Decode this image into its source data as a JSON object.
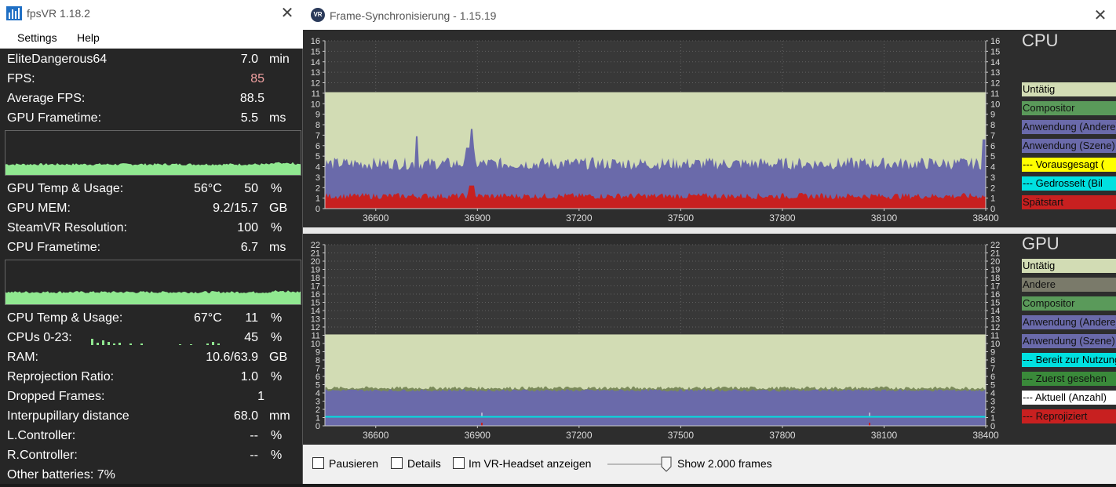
{
  "fpsvr": {
    "title": "fpsVR 1.18.2",
    "menu": [
      "Settings",
      "Help"
    ],
    "rows": [
      {
        "label": "EliteDangerous64",
        "value": "7.0",
        "unit": "min"
      },
      {
        "label": "FPS:",
        "value": "85",
        "unit": "",
        "value_color": "#f0a0a0"
      },
      {
        "label": "Average FPS:",
        "value": "88.5",
        "unit": ""
      },
      {
        "label": "GPU Frametime:",
        "value": "5.5",
        "unit": "ms"
      },
      {
        "label": "GPU Temp & Usage:",
        "value": "56°C",
        "value2": "50",
        "unit": "%"
      },
      {
        "label": "GPU MEM:",
        "value": "9.2/15.7",
        "unit": "GB"
      },
      {
        "label": "SteamVR Resolution:",
        "value": "100",
        "unit": "%"
      },
      {
        "label": "CPU Frametime:",
        "value": "6.7",
        "unit": "ms"
      },
      {
        "label": "CPU Temp & Usage:",
        "value": "67°C",
        "value2": "11",
        "unit": "%"
      },
      {
        "label": "CPUs 0-23:",
        "value": "45",
        "unit": "%"
      },
      {
        "label": "RAM:",
        "value": "10.6/63.9",
        "unit": "GB"
      },
      {
        "label": "Reprojection Ratio:",
        "value": "1.0",
        "unit": "%"
      },
      {
        "label": "Dropped Frames:",
        "value": "1",
        "unit": ""
      },
      {
        "label": "Interpupillary distance",
        "value": "68.0",
        "unit": "mm"
      },
      {
        "label": "L.Controller:",
        "value": "--",
        "unit": "%"
      },
      {
        "label": "R.Controller:",
        "value": "--",
        "unit": "%"
      },
      {
        "label": "Other batteries: 7%",
        "value": "",
        "unit": ""
      }
    ],
    "graph_color": "#90e890"
  },
  "framesync": {
    "title": "Frame-Synchronisierung - 1.15.19",
    "cpu_label": "CPU",
    "gpu_label": "GPU",
    "cpu_legend": [
      {
        "label": "Untätig",
        "color": "#d2dcb4"
      },
      {
        "label": "Compositor",
        "color": "#5a9a5a"
      },
      {
        "label": "Anwendung (Andere)",
        "color": "#6a6aaa"
      },
      {
        "label": "Anwendung (Szene)",
        "color": "#6a6aaa"
      },
      {
        "label": "--- Vorausgesagt (",
        "color": "#ffff00"
      },
      {
        "label": "--- Gedrosselt (Bil",
        "color": "#00e0e0"
      },
      {
        "label": "Spätstart",
        "color": "#c82020"
      }
    ],
    "gpu_legend": [
      {
        "label": "Untätig",
        "color": "#d2dcb4"
      },
      {
        "label": "Andere",
        "color": "#7a7a6a"
      },
      {
        "label": "Compositor",
        "color": "#5a9a5a"
      },
      {
        "label": "Anwendung (Andere)",
        "color": "#6a6aaa"
      },
      {
        "label": "Anwendung (Szene)",
        "color": "#6a6aaa"
      },
      {
        "label": "--- Bereit zur Nutzung",
        "color": "#00e0e0"
      },
      {
        "label": "--- Zuerst gesehen",
        "color": "#3a8a3a"
      },
      {
        "label": "--- Aktuell (Anzahl)",
        "color": "#ffffff"
      },
      {
        "label": "--- Reprojiziert",
        "color": "#c82020"
      }
    ],
    "x_ticks": [
      "36600",
      "36900",
      "37200",
      "37500",
      "37800",
      "38100",
      "38400"
    ],
    "controls": {
      "pause": "Pausieren",
      "details": "Details",
      "headset": "Im VR-Headset anzeigen",
      "frames": "Show 2.000 frames"
    }
  },
  "chart_data": [
    {
      "type": "area",
      "title": "CPU",
      "x_ticks": [
        36600,
        36900,
        37200,
        37500,
        37800,
        38100,
        38400
      ],
      "xlim": [
        36450,
        38400
      ],
      "ylim": [
        0,
        16
      ],
      "y_ticks": [
        0,
        1,
        2,
        3,
        4,
        5,
        6,
        7,
        8,
        9,
        10,
        11,
        12,
        13,
        14,
        15,
        16
      ],
      "series": [
        {
          "name": "Untätig",
          "values": [
            11.1
          ]
        },
        {
          "name": "Anwendung (Szene)",
          "approx_level": [
            4.3
          ]
        },
        {
          "name": "Spätstart",
          "approx_level": [
            1.3
          ]
        }
      ]
    },
    {
      "type": "area",
      "title": "GPU",
      "x_ticks": [
        36600,
        36900,
        37200,
        37500,
        37800,
        38100,
        38400
      ],
      "xlim": [
        36450,
        38400
      ],
      "ylim": [
        0,
        22
      ],
      "y_ticks": [
        0,
        1,
        2,
        3,
        4,
        5,
        6,
        7,
        8,
        9,
        10,
        11,
        12,
        13,
        14,
        15,
        16,
        17,
        18,
        19,
        20,
        21,
        22
      ],
      "series": [
        {
          "name": "Untätig",
          "values": [
            11.1
          ]
        },
        {
          "name": "Compositor",
          "approx_level": [
            4.6
          ]
        },
        {
          "name": "Anwendung (Szene)",
          "approx_level": [
            4.3
          ]
        },
        {
          "name": "--- Bereit zur Nutzung",
          "approx_level": [
            1.1
          ]
        }
      ]
    }
  ]
}
